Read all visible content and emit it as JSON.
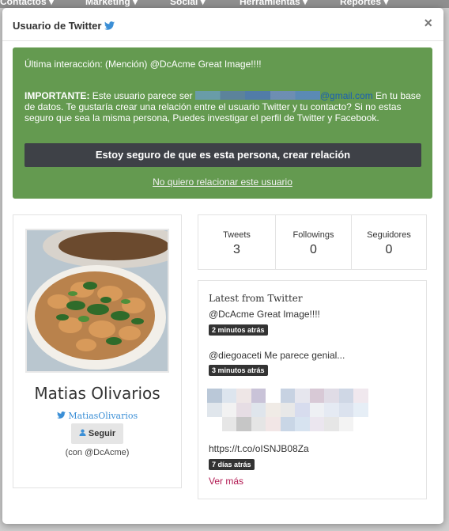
{
  "nav": {
    "items": [
      "Contactos ▾",
      "Marketing ▾",
      "Social ▾",
      "Herramientas ▾",
      "Reportes ▾"
    ]
  },
  "modal": {
    "title": "Usuario de Twitter",
    "close": "×"
  },
  "alert": {
    "last_interaction": "Última interacción: (Mención) @DcAcme Great Image!!!!",
    "important_label": "IMPORTANTE:",
    "text_before_email": " Este usuario parece ser ",
    "email": "@gmail.com",
    "text_after_email": " En tu base de datos. Te gustaría crear una relación entre el usuario Twitter y tu contacto? Si no estas seguro que sea la misma persona, Puedes investigar el perfil de Twitter y Facebook.",
    "confirm_button": "Estoy seguro de que es esta persona, crear relación",
    "decline_link": "No quiero relacionar este usuario"
  },
  "profile": {
    "name": "Matias Olivarios",
    "handle": "MatiasOlivarios",
    "follow_button": "Seguir",
    "via": "(con @DcAcme)"
  },
  "stats": [
    {
      "label": "Tweets",
      "value": "3"
    },
    {
      "label": "Followings",
      "value": "0"
    },
    {
      "label": "Seguidores",
      "value": "0"
    }
  ],
  "latest": {
    "title": "Latest from Twitter",
    "tweets": [
      {
        "text": "@DcAcme Great Image!!!!",
        "time": "2 minutos atrás"
      },
      {
        "text": "@diegoaceti Me parece genial...",
        "time": "3 minutos atrás"
      },
      {
        "text": "https://t.co/oISNJB08Za",
        "time": "7 días atrás"
      }
    ],
    "see_more": "Ver más"
  },
  "colors": {
    "alert_green": "#649a50",
    "confirm_dark": "#3e4147",
    "twitter_blue": "#3b8fd6",
    "see_more": "#b21a52"
  }
}
